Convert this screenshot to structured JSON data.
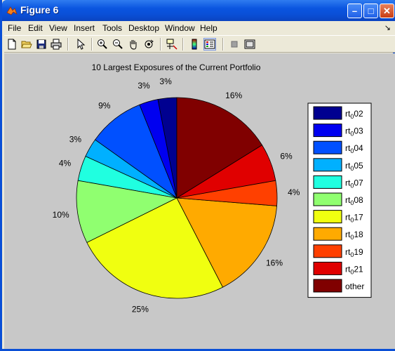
{
  "window": {
    "title": "Figure 6",
    "buttons": [
      "minimize",
      "maximize",
      "close"
    ]
  },
  "menubar": {
    "items": [
      "File",
      "Edit",
      "View",
      "Insert",
      "Tools",
      "Desktop",
      "Window",
      "Help"
    ]
  },
  "toolbar": {
    "icons": [
      "new-file-icon",
      "open-folder-icon",
      "save-icon",
      "print-icon",
      "pointer-icon",
      "zoom-in-icon",
      "zoom-out-icon",
      "pan-hand-icon",
      "rotate-3d-icon",
      "data-cursor-icon",
      "colorbar-icon",
      "legend-icon",
      "hide-plot-tools-icon",
      "show-plot-tools-icon"
    ]
  },
  "chart_data": {
    "type": "pie",
    "title": "10 Largest Exposures of  the Current Portfolio",
    "slices": [
      {
        "name": "rt_0 02",
        "base": "rt",
        "sub": "0",
        "suffix": "02",
        "value": 3,
        "label": "3%",
        "color": "#000090"
      },
      {
        "name": "rt_0 03",
        "base": "rt",
        "sub": "0",
        "suffix": "03",
        "value": 3,
        "label": "3%",
        "color": "#0000f0"
      },
      {
        "name": "rt_0 04",
        "base": "rt",
        "sub": "0",
        "suffix": "04",
        "value": 9,
        "label": "9%",
        "color": "#0050ff"
      },
      {
        "name": "rt_0 05",
        "base": "rt",
        "sub": "0",
        "suffix": "05",
        "value": 3,
        "label": "3%",
        "color": "#00b0ff"
      },
      {
        "name": "rt_0 07",
        "base": "rt",
        "sub": "0",
        "suffix": "07",
        "value": 4,
        "label": "4%",
        "color": "#20ffe0"
      },
      {
        "name": "rt_0 08",
        "base": "rt",
        "sub": "0",
        "suffix": "08",
        "value": 10,
        "label": "10%",
        "color": "#90ff70"
      },
      {
        "name": "rt_0 17",
        "base": "rt",
        "sub": "0",
        "suffix": "17",
        "value": 25,
        "label": "25%",
        "color": "#f0ff10"
      },
      {
        "name": "rt_0 18",
        "base": "rt",
        "sub": "0",
        "suffix": "18",
        "value": 16,
        "label": "16%",
        "color": "#ffaa00"
      },
      {
        "name": "rt_0 19",
        "base": "rt",
        "sub": "0",
        "suffix": "19",
        "value": 4,
        "label": "4%",
        "color": "#ff4000"
      },
      {
        "name": "rt_0 21",
        "base": "rt",
        "sub": "0",
        "suffix": "21",
        "value": 6,
        "label": "6%",
        "color": "#e00000"
      },
      {
        "name": "other",
        "base": "other",
        "sub": "",
        "suffix": "",
        "value": 16,
        "label": "16%",
        "color": "#800000"
      }
    ],
    "legend_position": "right",
    "order": "counterclockwise from 12 o'clock",
    "background": "#c8c8c8"
  }
}
